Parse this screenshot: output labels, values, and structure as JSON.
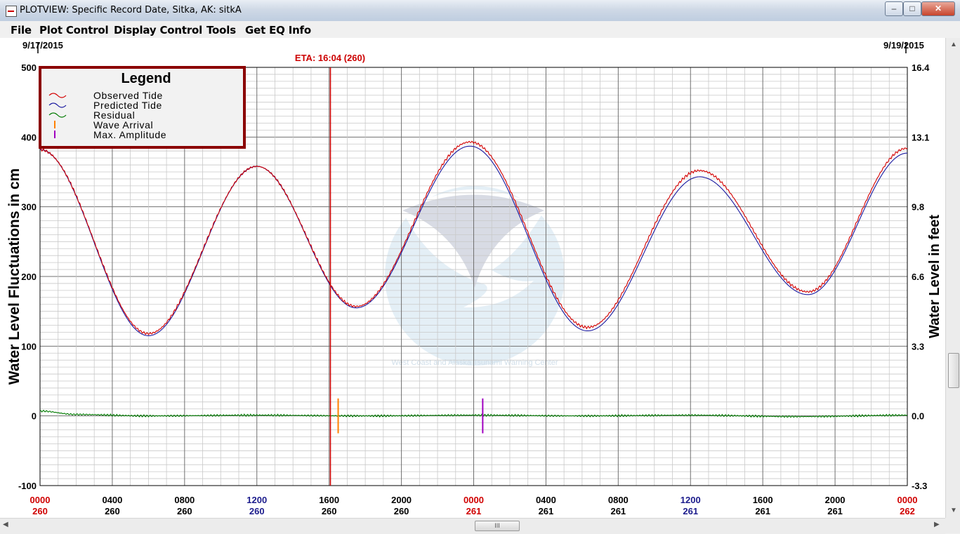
{
  "window": {
    "title": "PLOTVIEW: Specific Record Date, Sitka, AK: sitkA",
    "buttons": {
      "minimize": "–",
      "maximize": "□",
      "close": "✕"
    }
  },
  "menu": [
    "File",
    "Plot Control",
    "Display Control",
    "Tools",
    "Get EQ Info"
  ],
  "plot": {
    "start_date": "9/17/2015",
    "end_date": "9/19/2015",
    "eta_label": "ETA: 16:04 (260)",
    "ylabel_left": "Water Level Fluctuations in cm",
    "ylabel_right": "Water Level in feet",
    "left_ticks": [
      "500",
      "400",
      "300",
      "200",
      "100",
      "0",
      "-100"
    ],
    "right_ticks": [
      "16.4",
      "13.1",
      "9.8",
      "6.6",
      "3.3",
      "0.0",
      "-3.3"
    ],
    "x_ticks": [
      {
        "time": "0000",
        "day": "260",
        "color": "#d00000"
      },
      {
        "time": "0400",
        "day": "260",
        "color": "#000000"
      },
      {
        "time": "0800",
        "day": "260",
        "color": "#000000"
      },
      {
        "time": "1200",
        "day": "260",
        "color": "#1c1c8c"
      },
      {
        "time": "1600",
        "day": "260",
        "color": "#000000"
      },
      {
        "time": "2000",
        "day": "260",
        "color": "#000000"
      },
      {
        "time": "0000",
        "day": "261",
        "color": "#d00000"
      },
      {
        "time": "0400",
        "day": "261",
        "color": "#000000"
      },
      {
        "time": "0800",
        "day": "261",
        "color": "#000000"
      },
      {
        "time": "1200",
        "day": "261",
        "color": "#1c1c8c"
      },
      {
        "time": "1600",
        "day": "261",
        "color": "#000000"
      },
      {
        "time": "2000",
        "day": "261",
        "color": "#000000"
      },
      {
        "time": "0000",
        "day": "262",
        "color": "#d00000"
      }
    ],
    "watermark_text": "West Coast and Alaska Tsunami Warning Center",
    "colors": {
      "observed": "#d40000",
      "predicted": "#1a1aa0",
      "residual": "#007a00",
      "arrival": "#ff8000",
      "max_amp": "#a000c0",
      "eta": "#cc0000"
    }
  },
  "legend": {
    "title": "Legend",
    "items": [
      {
        "label": "Observed Tide",
        "color": "#d40000",
        "symbol": "wave"
      },
      {
        "label": "Predicted Tide",
        "color": "#1a1aa0",
        "symbol": "wave"
      },
      {
        "label": "Residual",
        "color": "#007a00",
        "symbol": "wave"
      },
      {
        "label": "Wave Arrival",
        "color": "#ff8000",
        "symbol": "tick"
      },
      {
        "label": "Max. Amplitude",
        "color": "#a000c0",
        "symbol": "tick"
      }
    ]
  },
  "chart_data": {
    "type": "line",
    "x_unit": "hour since 0000 day 260",
    "xlim": [
      0,
      48
    ],
    "ylim": [
      -100,
      500
    ],
    "ylim_right": [
      -3.3,
      16.4
    ],
    "grid": true,
    "legend_position": "top-left",
    "eta_hour": 16.07,
    "wave_arrival_hour": 16.5,
    "max_amplitude_hour": 24.5,
    "series": [
      {
        "name": "Observed Tide",
        "x": [
          0,
          6,
          12,
          17.5,
          23.8,
          30.3,
          36.5,
          42.5,
          48
        ],
        "y": [
          382,
          118,
          358,
          157,
          393,
          127,
          352,
          178,
          384
        ]
      },
      {
        "name": "Predicted Tide",
        "x": [
          0,
          6,
          12,
          17.5,
          23.8,
          30.3,
          36.5,
          42.5,
          48
        ],
        "y": [
          382,
          115,
          358,
          155,
          387,
          122,
          343,
          174,
          377
        ]
      },
      {
        "name": "Residual",
        "x": [
          0,
          2,
          6,
          12,
          18,
          24,
          30,
          36,
          42,
          48
        ],
        "y": [
          7,
          2,
          0,
          1,
          0,
          1,
          0,
          1,
          -1,
          1
        ]
      }
    ]
  }
}
